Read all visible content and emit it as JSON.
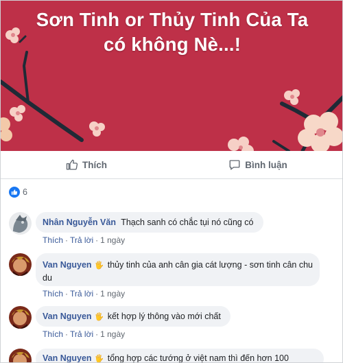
{
  "post": {
    "banner_title_line1": "Sơn Tinh or Thủy Tinh Của Ta",
    "banner_title_line2": "có không Nè...!",
    "banner_color": "#be3048"
  },
  "actions": {
    "like_label": "Thích",
    "comment_label": "Bình luận",
    "like_icon": "thumbs-up-icon",
    "comment_icon": "speech-bubble-icon"
  },
  "reactions": {
    "icon": "like-reaction-icon",
    "count": "6"
  },
  "comments": [
    {
      "author": "Nhân Nguyễn Văn",
      "text": "Thạch sanh có chắc tụi nó cũng có",
      "like": "Thích",
      "reply": "Trả lời",
      "time": "1 ngày"
    },
    {
      "author": "Van Nguyen",
      "badge": "🖐",
      "text": "thủy tinh của anh cân gia cát lượng - sơn tinh cân chu du",
      "like": "Thích",
      "reply": "Trả lời",
      "time": "1 ngày"
    },
    {
      "author": "Van Nguyen",
      "badge": "🖐",
      "text": "kết hợp lý thông vào mới chất",
      "like": "Thích",
      "reply": "Trả lời",
      "time": "1 ngày"
    },
    {
      "author": "Van Nguyen",
      "badge": "🖐",
      "text": "tổng hợp các tướng ở việt nam thì đến hơn 100"
    }
  ],
  "separator": "·"
}
